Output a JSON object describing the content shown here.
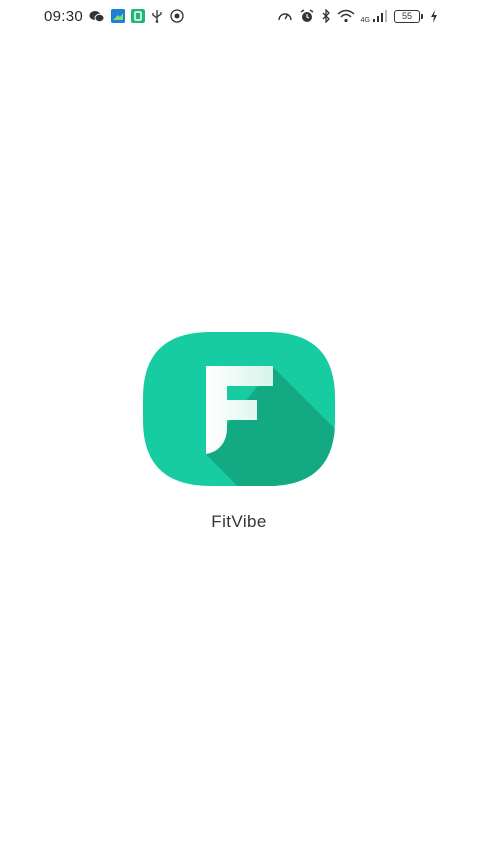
{
  "status_bar": {
    "time": "09:30",
    "left_icons": [
      "wechat-icon",
      "app-notification-icon",
      "app-notification-icon",
      "usb-icon",
      "location-icon"
    ],
    "right_icons": [
      "speed-icon",
      "alarm-icon",
      "bluetooth-icon",
      "wifi-icon",
      "signal-icon",
      "battery-icon",
      "charging-icon"
    ],
    "network_type": "4G",
    "battery_level": "55"
  },
  "splash": {
    "app_name": "FitVibe",
    "logo_letter": "F",
    "logo_color": "#17cca0",
    "logo_shadow_color": "#13a982"
  }
}
